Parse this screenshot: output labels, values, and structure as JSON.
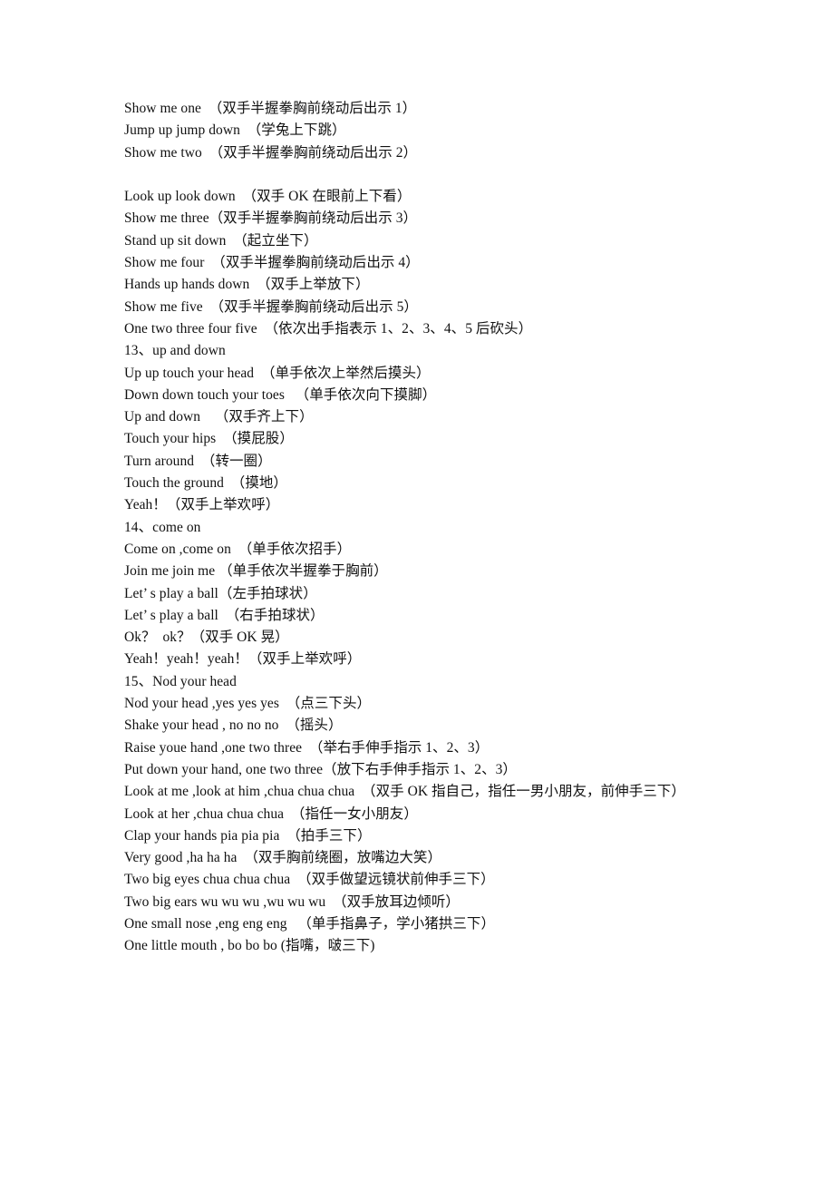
{
  "document": {
    "page_background": "#ffffff",
    "text_color": "#111111",
    "lines": [
      {
        "id": "line-show-me-one",
        "kind": "body",
        "text": "Show me one  （双手半握拳胸前绕动后出示 1）"
      },
      {
        "id": "line-jump-up-jump-down",
        "kind": "body",
        "text": "Jump up jump down  （学兔上下跳）"
      },
      {
        "id": "line-show-me-two",
        "kind": "body",
        "text": "Show me two  （双手半握拳胸前绕动后出示 2）"
      },
      {
        "id": "line-blank-1",
        "kind": "blank",
        "text": ""
      },
      {
        "id": "line-look-up-look-down",
        "kind": "body",
        "text": "Look up look down  （双手 OK 在眼前上下看）"
      },
      {
        "id": "line-show-me-three",
        "kind": "body",
        "text": "Show me three（双手半握拳胸前绕动后出示 3）"
      },
      {
        "id": "line-stand-up-sit-down",
        "kind": "body",
        "text": "Stand up sit down  （起立坐下）"
      },
      {
        "id": "line-show-me-four",
        "kind": "body",
        "text": "Show me four  （双手半握拳胸前绕动后出示 4）"
      },
      {
        "id": "line-hands-up-hands-down",
        "kind": "body",
        "text": "Hands up hands down  （双手上举放下）"
      },
      {
        "id": "line-show-me-five",
        "kind": "body",
        "text": "Show me five  （双手半握拳胸前绕动后出示 5）"
      },
      {
        "id": "line-one-two-three-four-five",
        "kind": "body",
        "text": "One two three four five  （依次出手指表示 1、2、3、4、5 后砍头）"
      },
      {
        "id": "line-heading-13",
        "kind": "heading",
        "text": "13、up and down"
      },
      {
        "id": "line-up-up-touch-your-head",
        "kind": "body",
        "text": "Up up touch your head  （单手依次上举然后摸头）"
      },
      {
        "id": "line-down-down-touch-your-toes",
        "kind": "body",
        "text": "Down down touch your toes   （单手依次向下摸脚）"
      },
      {
        "id": "line-up-and-down",
        "kind": "body",
        "text": "Up and down    （双手齐上下）"
      },
      {
        "id": "line-touch-your-hips",
        "kind": "body",
        "text": "Touch your hips  （摸屁股）"
      },
      {
        "id": "line-turn-around",
        "kind": "body",
        "text": "Turn around  （转一圈）"
      },
      {
        "id": "line-touch-the-ground",
        "kind": "body",
        "text": "Touch the ground  （摸地）"
      },
      {
        "id": "line-yeah",
        "kind": "body",
        "text": "Yeah！（双手上举欢呼）"
      },
      {
        "id": "line-heading-14",
        "kind": "heading",
        "text": "14、come on"
      },
      {
        "id": "line-come-on-come-on",
        "kind": "body",
        "text": "Come on ,come on  （单手依次招手）"
      },
      {
        "id": "line-join-me-join-me",
        "kind": "body",
        "text": "Join me join me （单手依次半握拳于胸前）"
      },
      {
        "id": "line-lets-play-a-ball-left",
        "kind": "body",
        "text": "Let’ s play a ball（左手拍球状）"
      },
      {
        "id": "line-lets-play-a-ball-right",
        "kind": "body",
        "text": "Let’ s play a ball  （右手拍球状）"
      },
      {
        "id": "line-ok-ok",
        "kind": "body",
        "text": "Ok？  ok？（双手 OK 晃）"
      },
      {
        "id": "line-yeah-yeah-yeah",
        "kind": "body",
        "text": "Yeah！yeah！yeah！（双手上举欢呼）"
      },
      {
        "id": "line-heading-15",
        "kind": "heading",
        "text": "15、Nod your head"
      },
      {
        "id": "line-nod-your-head",
        "kind": "body",
        "text": "Nod your head ,yes yes yes  （点三下头）"
      },
      {
        "id": "line-shake-your-head",
        "kind": "body",
        "text": "Shake your head , no no no  （摇头）"
      },
      {
        "id": "line-raise-youe-hand",
        "kind": "body",
        "text": "Raise youe hand ,one two three  （举右手伸手指示 1、2、3）"
      },
      {
        "id": "line-put-down-your-hand",
        "kind": "body",
        "text": "Put down your hand, one two three（放下右手伸手指示 1、2、3）"
      },
      {
        "id": "line-look-at-me-look-at-him",
        "kind": "body",
        "text": "Look at me ,look at him ,chua chua chua  （双手 OK 指自己，指任一男小朋友，前伸手三下）"
      },
      {
        "id": "line-look-at-her",
        "kind": "body",
        "text": "Look at her ,chua chua chua  （指任一女小朋友）"
      },
      {
        "id": "line-clap-your-hands",
        "kind": "body",
        "text": "Clap your hands pia pia pia  （拍手三下）"
      },
      {
        "id": "line-very-good",
        "kind": "body",
        "text": "Very good ,ha ha ha  （双手胸前绕圈，放嘴边大笑）"
      },
      {
        "id": "line-two-big-eyes",
        "kind": "body",
        "text": "Two big eyes chua chua chua  （双手做望远镜状前伸手三下）"
      },
      {
        "id": "line-two-big-ears",
        "kind": "body",
        "text": "Two big ears wu wu wu ,wu wu wu  （双手放耳边倾听）"
      },
      {
        "id": "line-one-small-nose",
        "kind": "body",
        "text": "One small nose ,eng eng eng   （单手指鼻子，学小猪拱三下）"
      },
      {
        "id": "line-one-little-mouth",
        "kind": "body",
        "text": "One little mouth , bo bo bo (指嘴，啵三下)"
      }
    ]
  }
}
